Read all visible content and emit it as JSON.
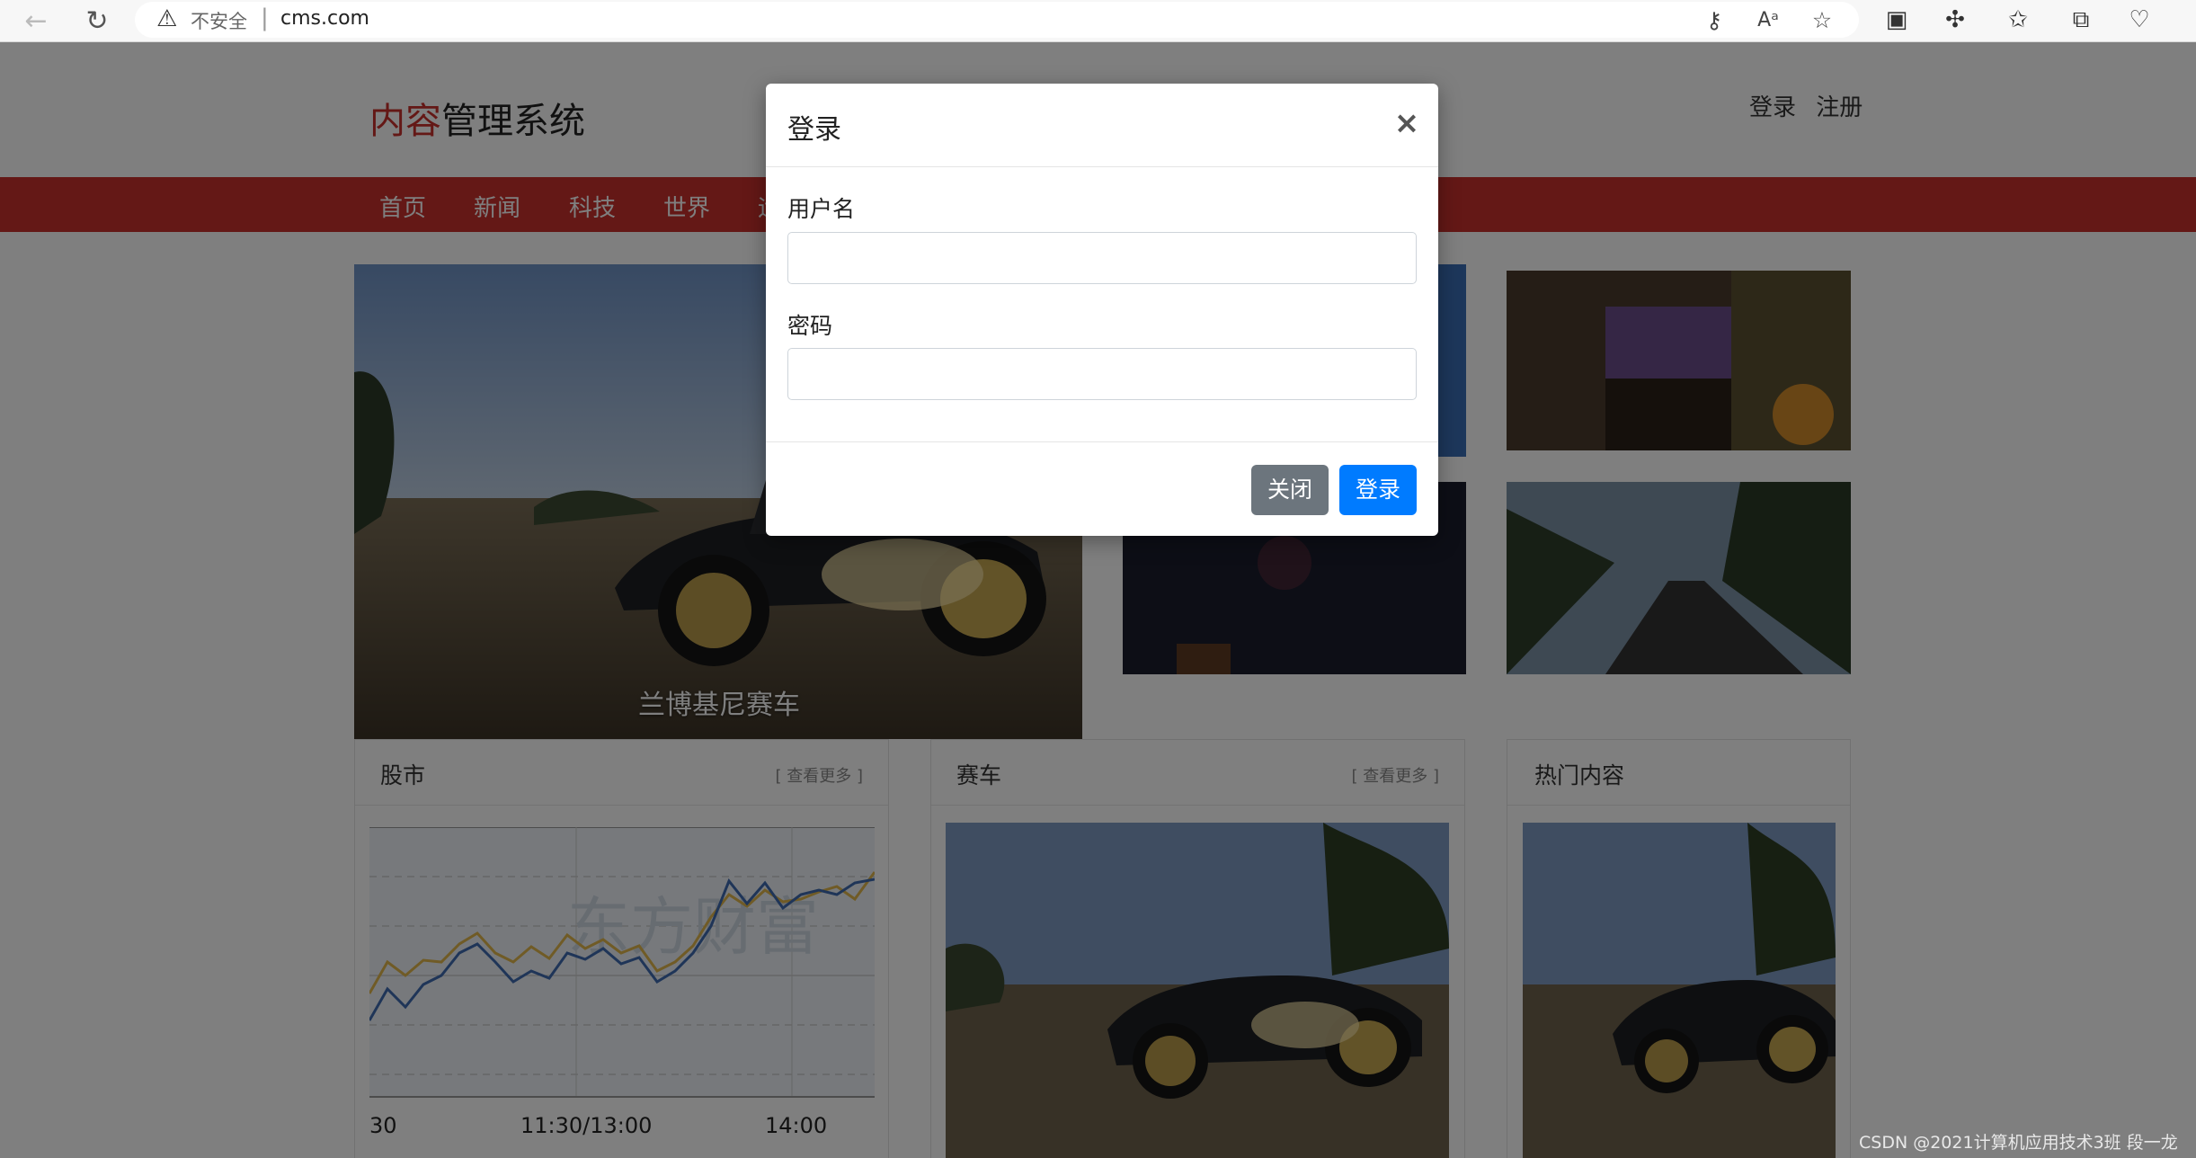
{
  "browser": {
    "insecure_label": "不安全",
    "url": "cms.com"
  },
  "site": {
    "logo_red": "内容",
    "logo_rest": "管理系统",
    "header_links": [
      "登录",
      "注册"
    ],
    "nav": [
      "首页",
      "新闻",
      "科技",
      "世界",
      "运"
    ]
  },
  "carousel": {
    "caption": "兰博基尼赛车"
  },
  "panels": {
    "stock": {
      "title": "股市",
      "more": "[ 查看更多 ]"
    },
    "racing": {
      "title": "赛车",
      "more": "[ 查看更多 ]"
    },
    "hot": {
      "title": "热门内容"
    }
  },
  "stock_chart": {
    "x_tick_labels": [
      "30",
      "11:30/13:00",
      "14:00"
    ],
    "watermark_text": "东方财富"
  },
  "modal": {
    "title": "登录",
    "close_symbol": "×",
    "username_label": "用户名",
    "username_value": "",
    "password_label": "密码",
    "password_value": "",
    "close_button": "关闭",
    "login_button": "登录"
  },
  "footer_watermark": "CSDN @2021计算机应用技术3班 段一龙",
  "colors": {
    "brand_red": "#c9302c",
    "primary_blue": "#007bff",
    "secondary_gray": "#6c757d",
    "overlay": "rgba(0,0,0,0.5)"
  }
}
